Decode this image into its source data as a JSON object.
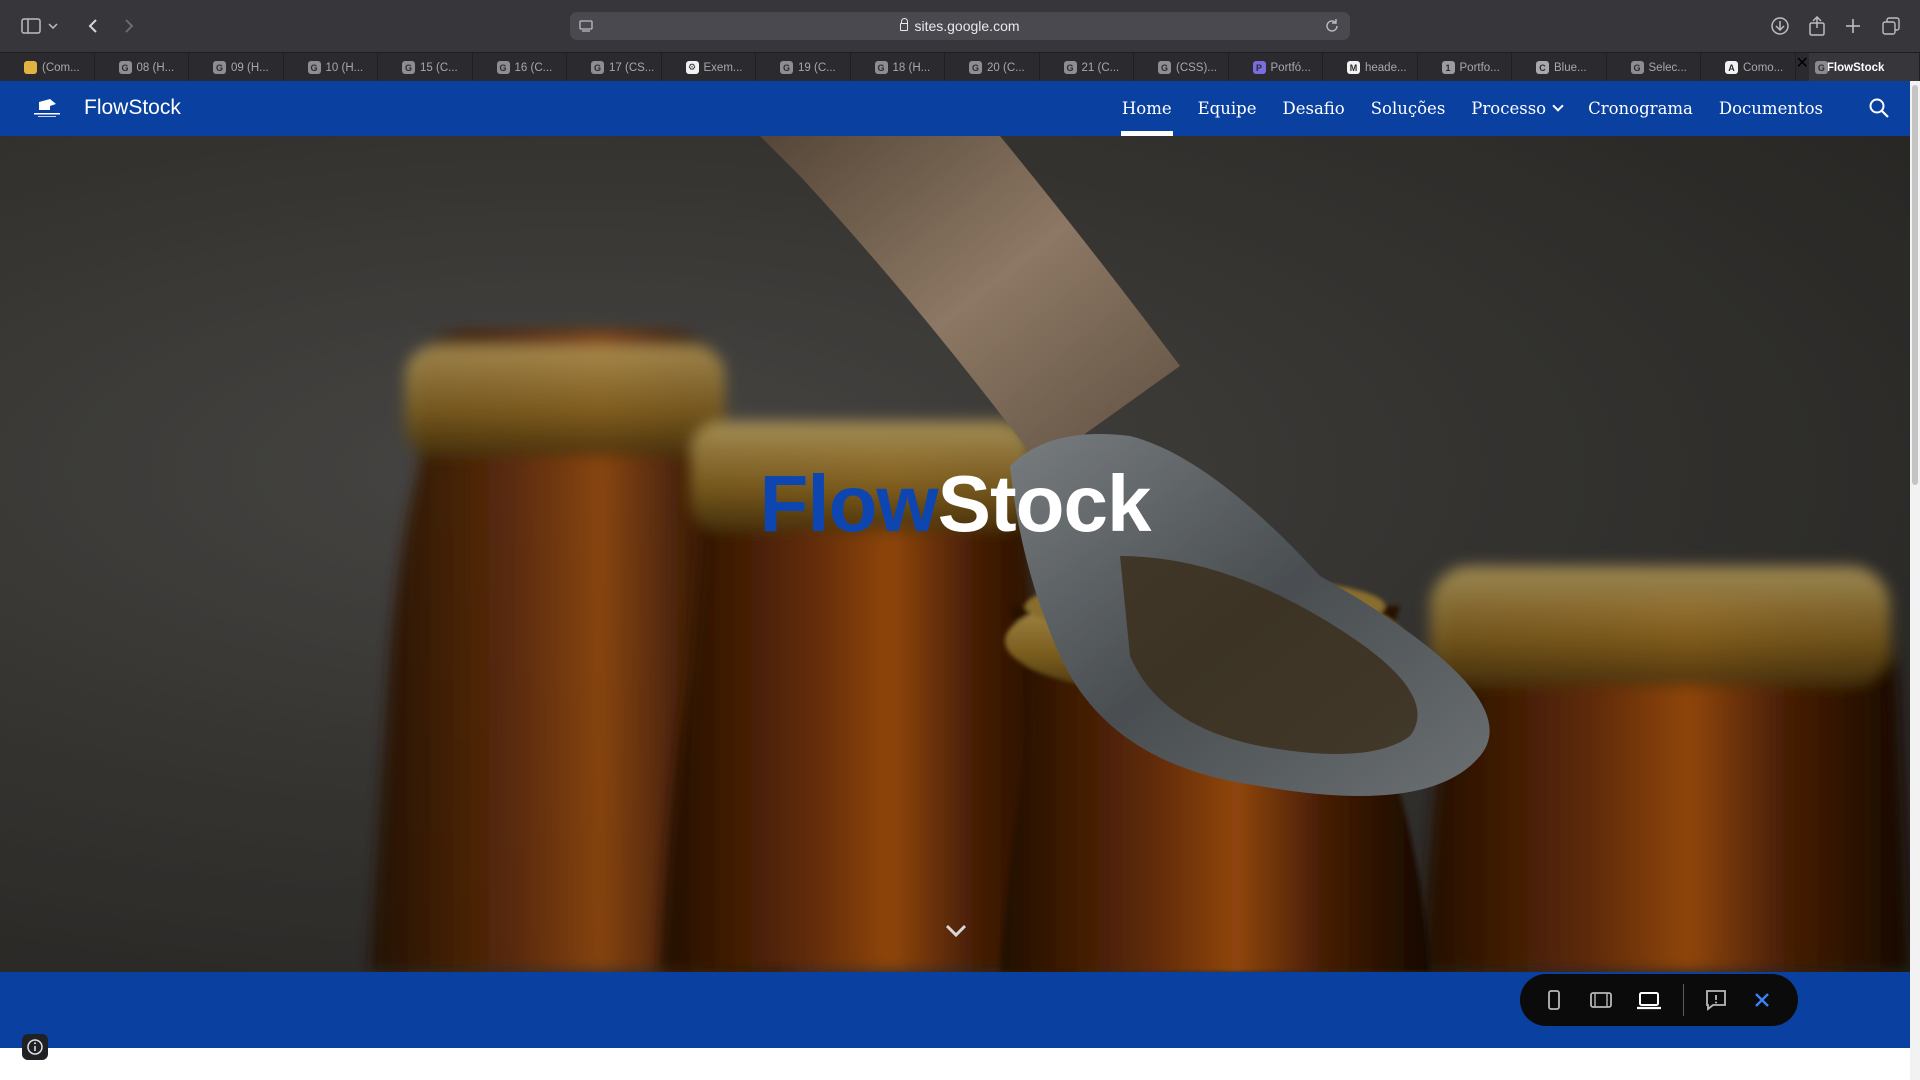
{
  "browser": {
    "url": "sites.google.com",
    "tabs": [
      {
        "label": "(Com...",
        "favicon": "folder-icon"
      },
      {
        "label": "08 (H...",
        "favicon": "G"
      },
      {
        "label": "09 (H...",
        "favicon": "G"
      },
      {
        "label": "10 (H...",
        "favicon": "G"
      },
      {
        "label": "15 (C...",
        "favicon": "G"
      },
      {
        "label": "16 (C...",
        "favicon": "G"
      },
      {
        "label": "17 (CS...",
        "favicon": "G"
      },
      {
        "label": "Exem...",
        "favicon": "⚙"
      },
      {
        "label": "19 (C...",
        "favicon": "G"
      },
      {
        "label": "18 (H...",
        "favicon": "G"
      },
      {
        "label": "20 (C...",
        "favicon": "G"
      },
      {
        "label": "21 (C...",
        "favicon": "G"
      },
      {
        "label": "(CSS)...",
        "favicon": "G"
      },
      {
        "label": "Portfó...",
        "favicon": "P"
      },
      {
        "label": "heade...",
        "favicon": "M"
      },
      {
        "label": "Portfo...",
        "favicon": "1"
      },
      {
        "label": "Blue...",
        "favicon": "C"
      },
      {
        "label": "Selec...",
        "favicon": "G"
      },
      {
        "label": "Como...",
        "favicon": "A"
      }
    ],
    "active_tab": {
      "label": "FlowStock",
      "favicon": "G"
    }
  },
  "site": {
    "title": "FlowStock",
    "nav": [
      {
        "label": "Home",
        "active": true
      },
      {
        "label": "Equipe"
      },
      {
        "label": "Desafio"
      },
      {
        "label": "Soluções"
      },
      {
        "label": "Processo",
        "has_dropdown": true
      },
      {
        "label": "Cronograma"
      },
      {
        "label": "Documentos"
      }
    ],
    "brand_color": "#0a40a0"
  },
  "hero": {
    "title_part1": "Flow",
    "title_part2": "Stock"
  }
}
